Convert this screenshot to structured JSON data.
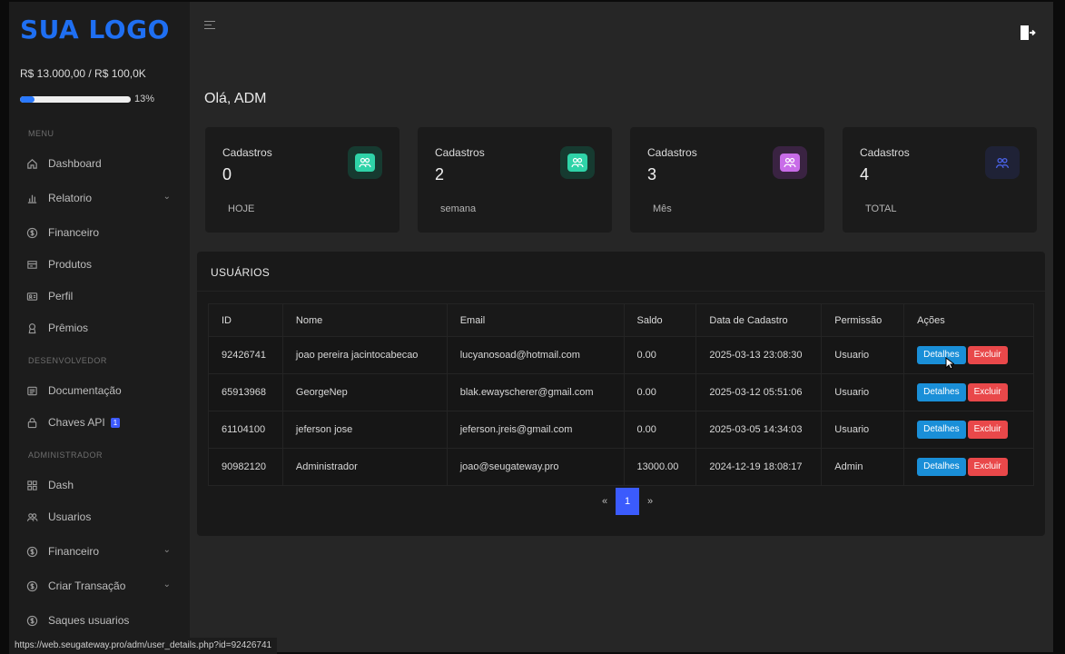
{
  "sidebar": {
    "logo": "SUA LOGO",
    "balance": "R$ 13.000,00 / R$ 100,0K",
    "progress": {
      "fraction": 0.13,
      "label": "13%"
    },
    "sections": {
      "menu": "MENU",
      "developer": "DESENVOLVEDOR",
      "admin": "ADMINISTRADOR"
    },
    "items": [
      {
        "label": "Dashboard",
        "icon": "home-icon"
      },
      {
        "label": "Relatorio",
        "icon": "bar-chart-icon",
        "expandable": true
      },
      {
        "label": "Financeiro",
        "icon": "dollar-circle-icon"
      },
      {
        "label": "Produtos",
        "icon": "box-icon"
      },
      {
        "label": "Perfil",
        "icon": "id-card-icon"
      },
      {
        "label": "Prêmios",
        "icon": "award-icon"
      },
      {
        "label": "Documentação",
        "icon": "document-icon"
      },
      {
        "label": "Chaves API",
        "icon": "lock-icon",
        "badge": "1"
      },
      {
        "label": "Dash",
        "icon": "grid-icon"
      },
      {
        "label": "Usuarios",
        "icon": "users-icon"
      },
      {
        "label": "Financeiro",
        "icon": "dollar-circle-icon",
        "expandable": true
      },
      {
        "label": "Criar Transação",
        "icon": "dollar-circle-icon",
        "expandable": true
      },
      {
        "label": "Saques usuarios",
        "icon": "dollar-circle-icon"
      }
    ]
  },
  "header": {
    "greeting": "Olá, ADM",
    "logout_icon": "logout-icon",
    "menu_icon": "hamburger-icon"
  },
  "cards": [
    {
      "label": "Cadastros",
      "value": "0",
      "sub": "HOJE",
      "color": "#2fd3a8",
      "bg": "#163a30"
    },
    {
      "label": "Cadastros",
      "value": "2",
      "sub": "semana",
      "color": "#2fd3a8",
      "bg": "#163a30"
    },
    {
      "label": "Cadastros",
      "value": "3",
      "sub": "Mês",
      "color": "#c86ce8",
      "bg": "#3a2342"
    },
    {
      "label": "Cadastros",
      "value": "4",
      "sub": "TOTAL",
      "color": "#4a63e8",
      "bg": "#1f2236"
    }
  ],
  "users_panel": {
    "title": "USUÁRIOS",
    "columns": [
      "ID",
      "Nome",
      "Email",
      "Saldo",
      "Data de Cadastro",
      "Permissão",
      "Ações"
    ],
    "rows": [
      {
        "id": "92426741",
        "name": "joao pereira jacintocabecao",
        "email": "lucyanosoad@hotmail.com",
        "balance": "0.00",
        "date": "2025-03-13 23:08:30",
        "permission": "Usuario"
      },
      {
        "id": "65913968",
        "name": "GeorgeNep",
        "email": "blak.ewayscherer@gmail.com",
        "balance": "0.00",
        "date": "2025-03-12 05:51:06",
        "permission": "Usuario"
      },
      {
        "id": "61104100",
        "name": "jeferson jose",
        "email": "jeferson.jreis@gmail.com",
        "balance": "0.00",
        "date": "2025-03-05 14:34:03",
        "permission": "Usuario"
      },
      {
        "id": "90982120",
        "name": "Administrador",
        "email": "joao@seugateway.pro",
        "balance": "13000.00",
        "date": "2024-12-19 18:08:17",
        "permission": "Admin"
      }
    ],
    "actions": {
      "details": "Detalhes",
      "delete": "Excluir"
    },
    "pagination": {
      "prev": "«",
      "current": "1",
      "next": "»"
    }
  },
  "status_url": "https://web.seugateway.pro/adm/user_details.php?id=92426741",
  "colors": {
    "accent": "#1f6ff2",
    "details_button": "#1a8fd8",
    "delete_button": "#e9484a",
    "pagination_active": "#3b5bfd"
  }
}
